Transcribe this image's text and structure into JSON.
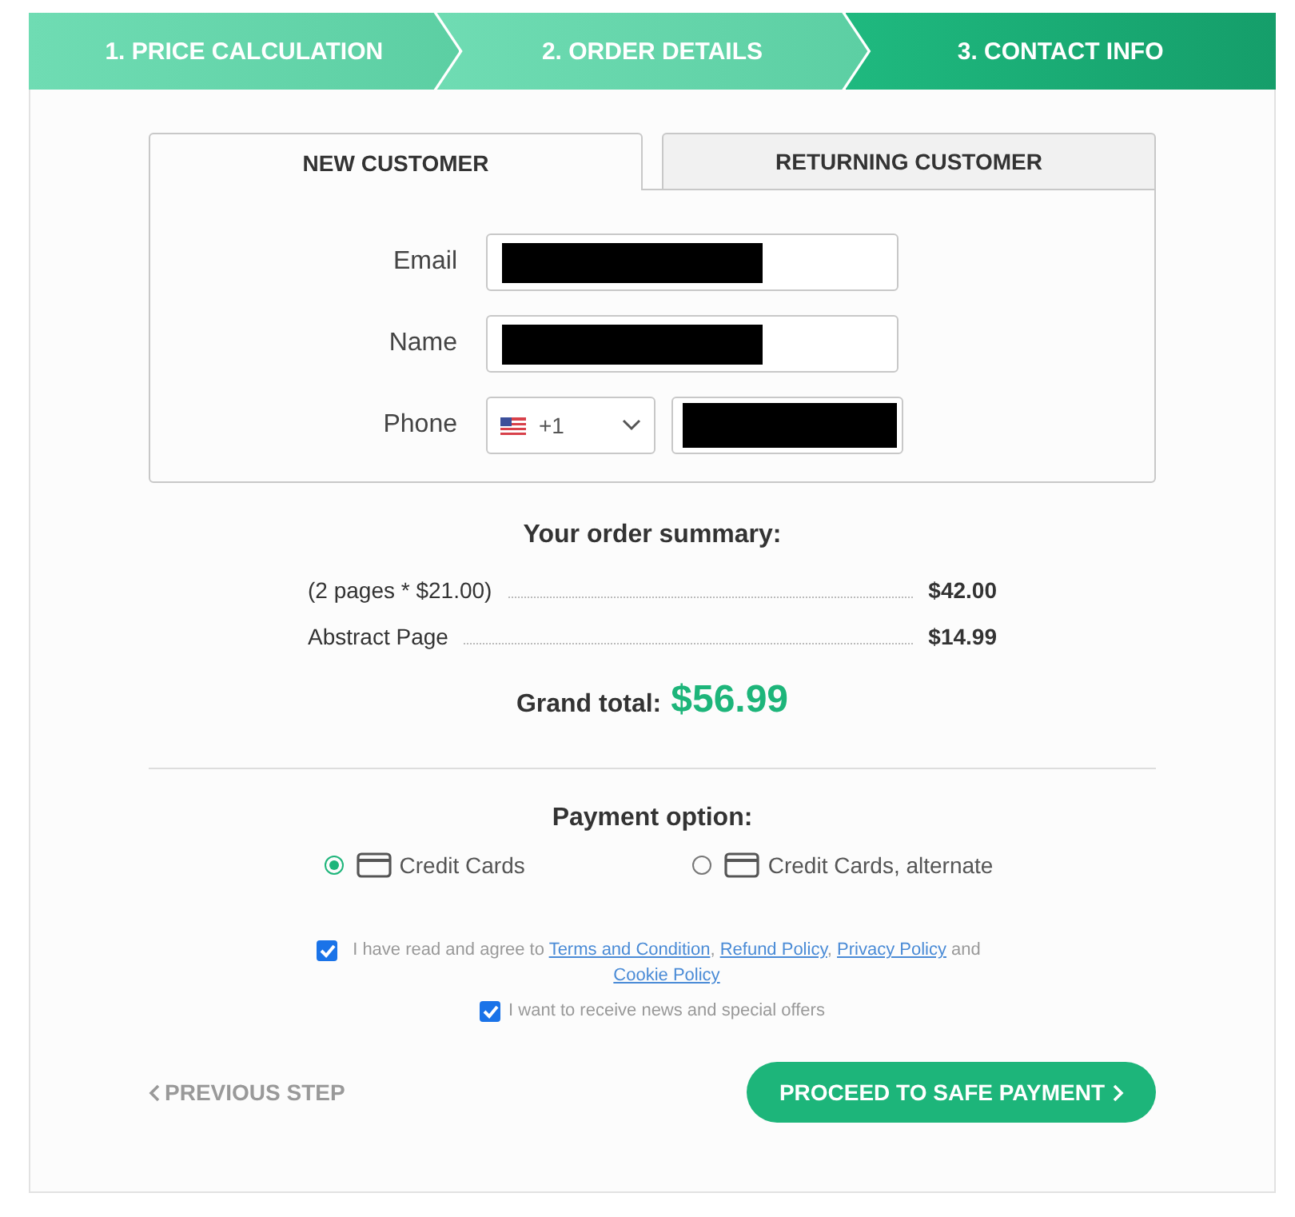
{
  "steps": [
    {
      "label": "1. PRICE CALCULATION",
      "selected": false
    },
    {
      "label": "2. ORDER DETAILS",
      "selected": false
    },
    {
      "label": "3. CONTACT INFO",
      "selected": true
    }
  ],
  "tabs": [
    {
      "label": "NEW CUSTOMER",
      "selected": true
    },
    {
      "label": "RETURNING CUSTOMER",
      "selected": false
    }
  ],
  "fields": [
    {
      "label": "Email",
      "kind": "text",
      "redacted": true
    },
    {
      "label": "Name",
      "kind": "text",
      "redacted": true
    },
    {
      "label": "Phone",
      "kind": "phone",
      "country_code": "+1",
      "redacted": true
    }
  ],
  "summary": {
    "title": "Your order summary:",
    "lines": [
      {
        "item": "(2 pages * $21.00)",
        "amount": "$42.00"
      },
      {
        "item": "Abstract Page",
        "amount": "$14.99"
      }
    ],
    "total_label": "Grand total:",
    "total": "$56.99"
  },
  "payment": {
    "title": "Payment option:",
    "options": [
      {
        "label": "Credit Cards",
        "selected": true
      },
      {
        "label": "Credit Cards, alternate",
        "selected": false
      }
    ]
  },
  "agreements": [
    {
      "checked": true,
      "parts": [
        {
          "text": "I have read and agree to "
        },
        {
          "link": "Terms and Condition"
        },
        {
          "text": ", "
        },
        {
          "link": "Refund Policy"
        },
        {
          "text": ", "
        },
        {
          "link": "Privacy Policy"
        },
        {
          "text": " and "
        },
        {
          "link": "Cookie Policy"
        }
      ]
    },
    {
      "checked": true,
      "parts": [
        {
          "text": "I want to receive news and special offers"
        }
      ]
    }
  ],
  "back_button": "PREVIOUS STEP",
  "next_button": "PROCEED TO SAFE PAYMENT"
}
